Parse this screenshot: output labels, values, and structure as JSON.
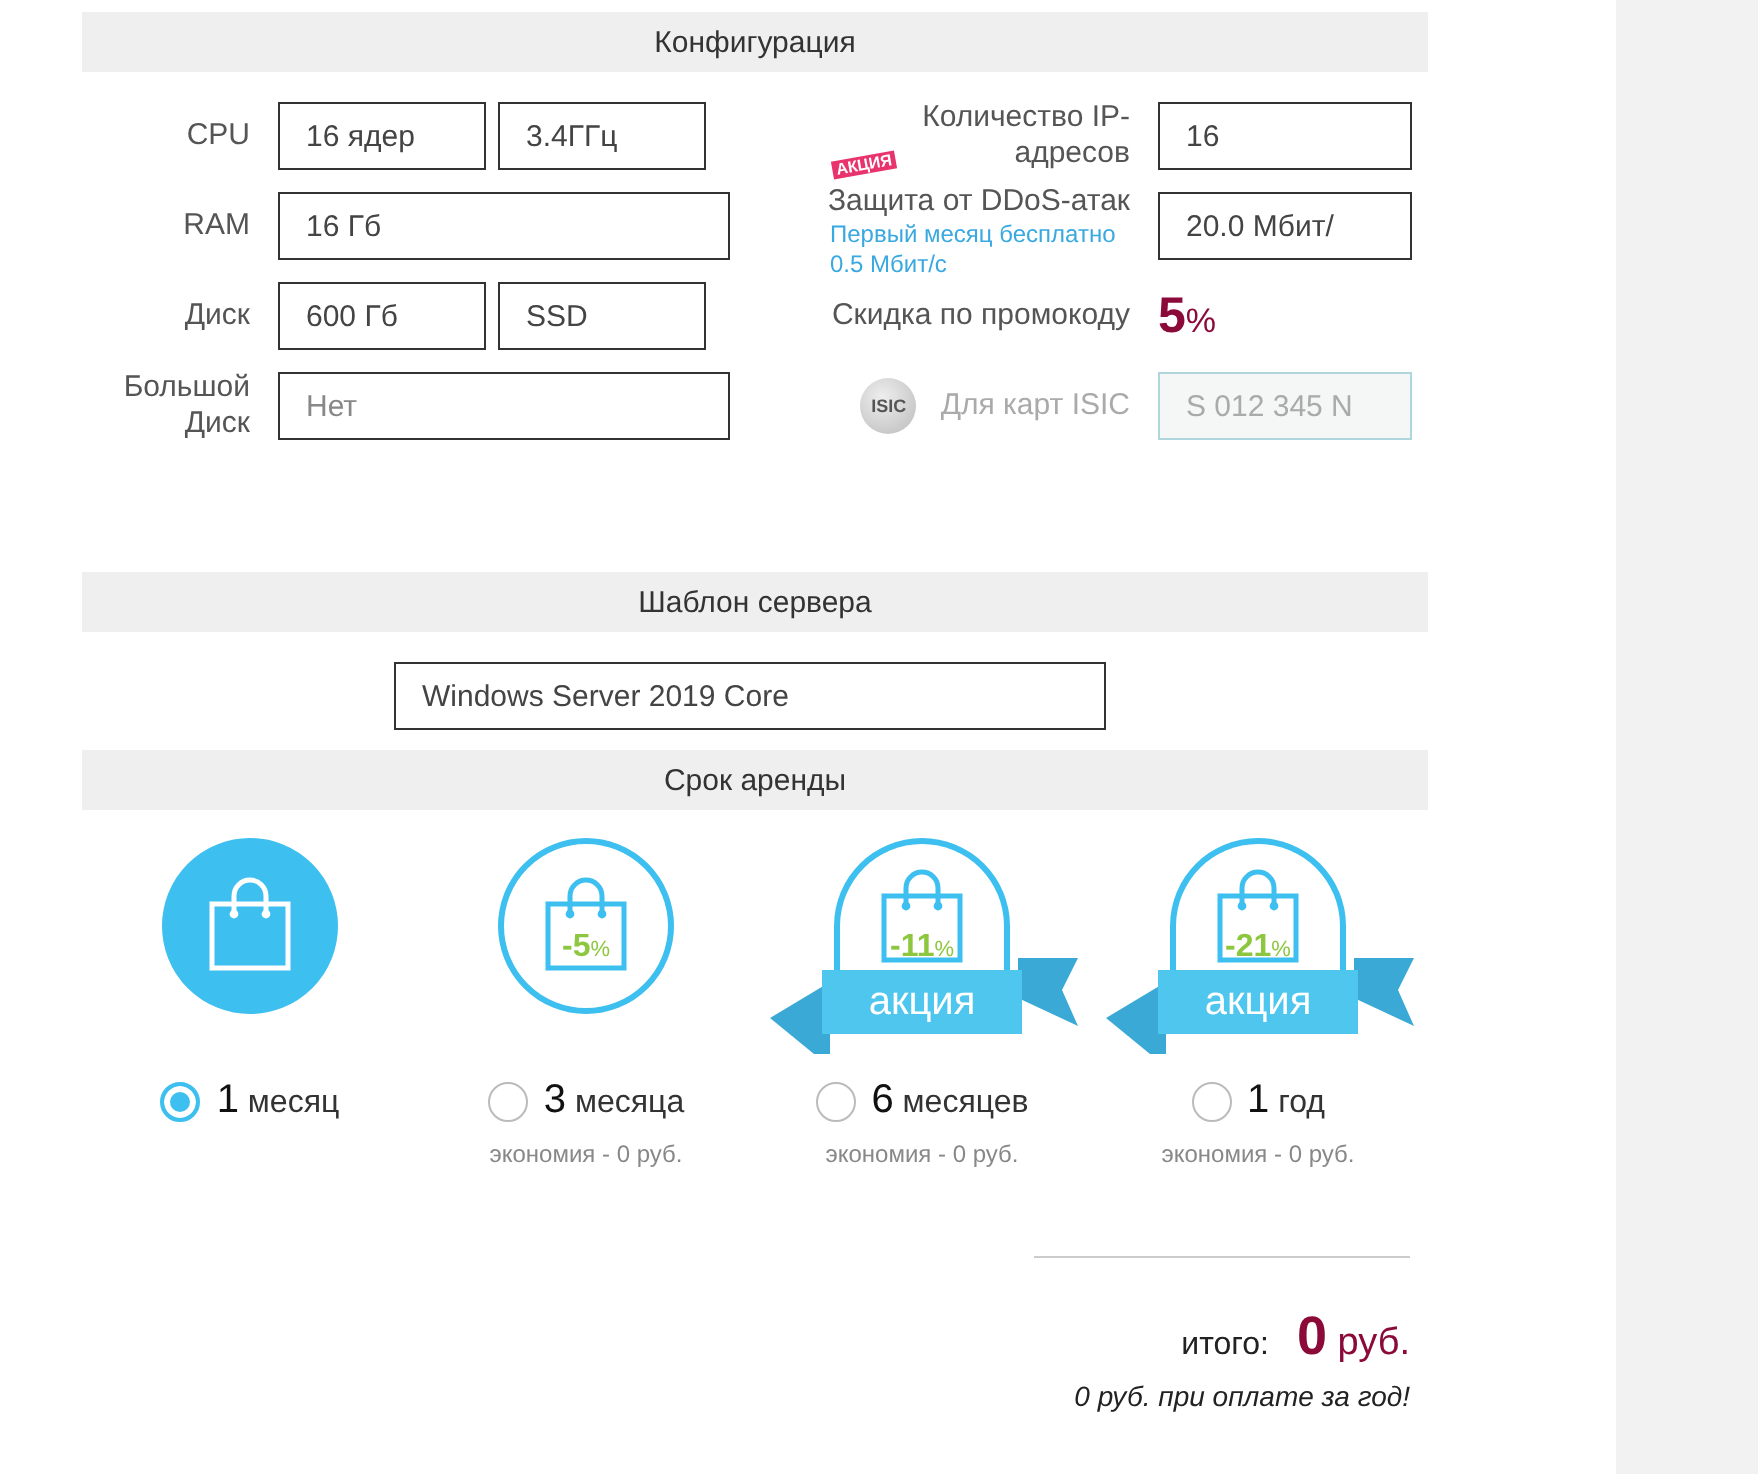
{
  "config": {
    "title": "Конфигурация",
    "left": [
      {
        "label": "CPU",
        "inputs": [
          {
            "value": "16 ядер"
          },
          {
            "value": "3.4ГГц"
          }
        ]
      },
      {
        "label": "RAM",
        "inputs": [
          {
            "value": "16 Гб"
          }
        ]
      },
      {
        "label": "Диск",
        "inputs": [
          {
            "value": "600 Гб"
          },
          {
            "value": "SSD"
          }
        ]
      },
      {
        "label": "Большой Диск",
        "inputs": [
          {
            "placeholder": "Нет"
          }
        ]
      }
    ],
    "ip": {
      "label": "Количество IP-адресов",
      "value": "16"
    },
    "ddos": {
      "badge": "АКЦИЯ",
      "label": "Защита от DDoS-атак",
      "note": "Первый месяц бесплатно 0.5 Мбит/с",
      "value": "20.0 Мбит/"
    },
    "promo": {
      "label": "Скидка по промокоду",
      "value": "5",
      "unit": "%"
    },
    "isic": {
      "icon_text": "ISIC",
      "label": "Для карт ISIC",
      "placeholder": "S 012 345 N",
      "disabled": true
    }
  },
  "template": {
    "title": "Шаблон сервера",
    "value": "Windows Server 2019 Core"
  },
  "rent": {
    "title": "Срок аренды",
    "options": [
      {
        "number": "1",
        "unit": "месяц",
        "selected": true
      },
      {
        "number": "3",
        "unit": "месяца",
        "selected": false,
        "discount": "-5",
        "percent": "%",
        "savings": "экономия - 0 руб."
      },
      {
        "number": "6",
        "unit": "месяцев",
        "selected": false,
        "discount": "-11",
        "percent": "%",
        "ribbon": "акция",
        "savings": "экономия - 0 руб."
      },
      {
        "number": "1",
        "unit": "год",
        "selected": false,
        "discount": "-21",
        "percent": "%",
        "ribbon": "акция",
        "savings": "экономия - 0 руб."
      }
    ]
  },
  "total": {
    "label": "итого:",
    "value": "0",
    "currency": "руб.",
    "note": "0 руб. при оплате за год!"
  }
}
